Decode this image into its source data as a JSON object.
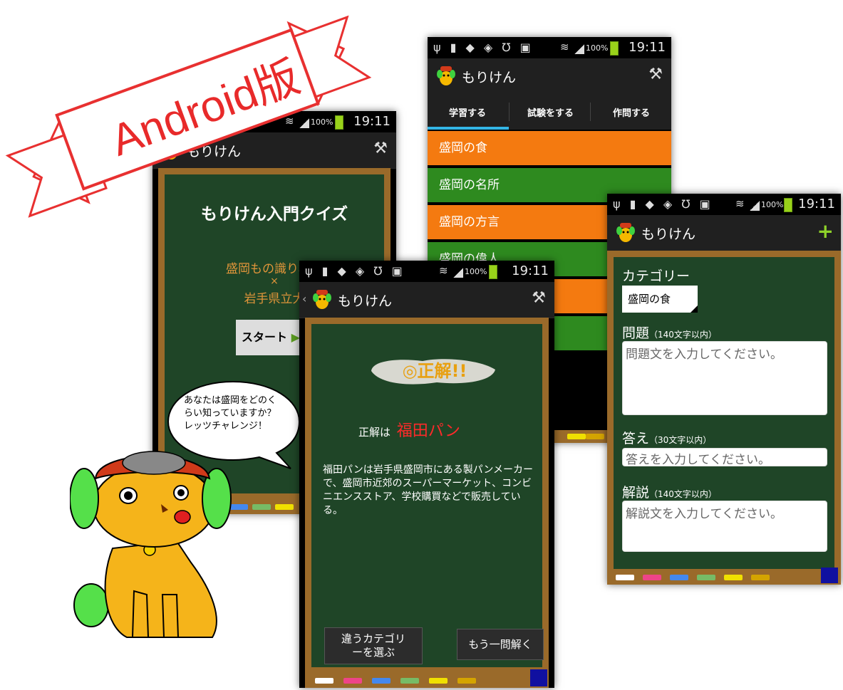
{
  "banner": {
    "text": "Android版"
  },
  "status": {
    "time": "19:11",
    "battery": "100%"
  },
  "app": {
    "title": "もりけん"
  },
  "home": {
    "heading": "もりけん入門クイズ",
    "subtitle_line1": "盛岡もの識り検定",
    "subtitle_x": "×",
    "subtitle_line3": "岩手県立大",
    "start_label": "スタート",
    "bubble_text": "あなたは盛岡をどのくらい知っていますか？レッツチャレンジ！"
  },
  "tabs": [
    "学習する",
    "試験をする",
    "作問する"
  ],
  "categories": [
    "盛岡の食",
    "盛岡の名所",
    "盛岡の方言",
    "盛岡の偉人"
  ],
  "result": {
    "banner": "◎正解!!",
    "answer_prefix": "正解は",
    "answer": "福田パン",
    "explanation": "福田パンは岩手県盛岡市にある製パンメーカーで、盛岡市近郊のスーパーマーケット、コンビニエンスストア、学校購買などで販売している。",
    "btn_other_category": "違うカテゴリーを選ぶ",
    "btn_another": "もう一問解く"
  },
  "create": {
    "category_label": "カテゴリー",
    "category_value": "盛岡の食",
    "question_label": "問題",
    "question_limit": "（140文字以内）",
    "question_placeholder": "問題文を入力してください。",
    "answer_label": "答え",
    "answer_limit": "（30文字以内）",
    "answer_placeholder": "答えを入力してください。",
    "explain_label": "解説",
    "explain_limit": "（140文字以内）",
    "explain_placeholder": "解説文を入力してください。"
  },
  "colors": {
    "board": "#1f4527",
    "frame": "#9a6a2a",
    "orange": "#f47a10",
    "green": "#2e8a1f",
    "accent_red": "#e02020",
    "tab_indicator": "#33b5e5"
  }
}
